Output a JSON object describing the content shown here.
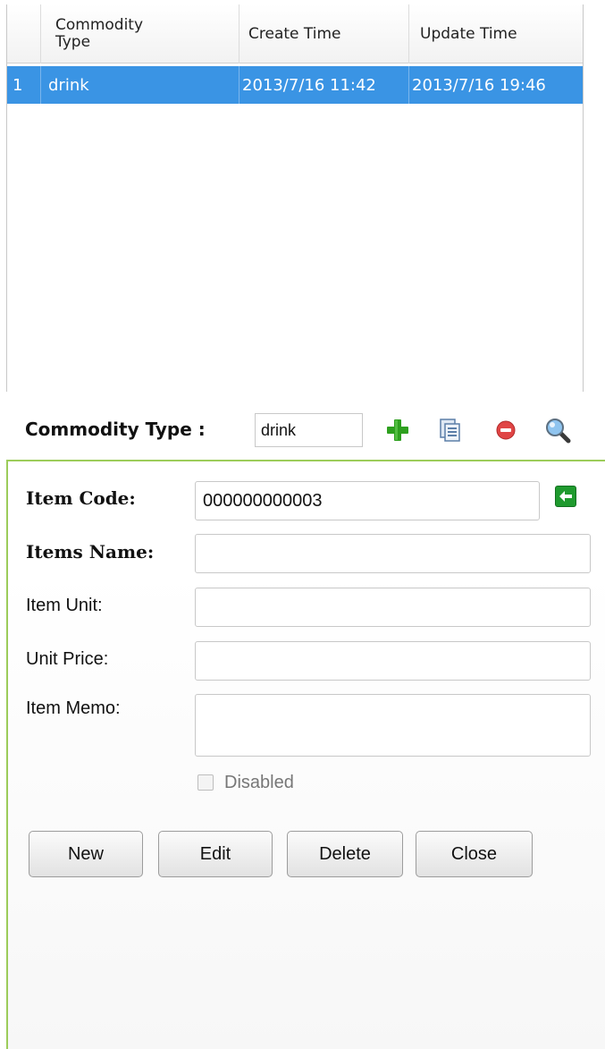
{
  "grid": {
    "columns": [
      "",
      "Commodity Type",
      "Create Time",
      "Update Time"
    ],
    "rows": [
      {
        "index": "1",
        "type": "drink",
        "create_time": "2013/7/16 11:42",
        "update_time": "2013/7/16 19:46",
        "selected": true
      }
    ]
  },
  "toolbar": {
    "label": "Commodity Type :",
    "type_value": "drink",
    "icons": [
      "add-icon",
      "save-icon",
      "remove-icon",
      "search-icon"
    ]
  },
  "form": {
    "item_code": {
      "label": "Item Code:",
      "value": "000000000003"
    },
    "items_name": {
      "label": "Items Name:",
      "value": ""
    },
    "item_unit": {
      "label": "Item Unit:",
      "value": ""
    },
    "unit_price": {
      "label": "Unit Price:",
      "value": ""
    },
    "item_memo": {
      "label": "Item Memo:",
      "value": ""
    },
    "disabled": {
      "label": "Disabled",
      "checked": false
    },
    "buttons": {
      "new": "New",
      "edit": "Edit",
      "delete": "Delete",
      "close": "Close"
    }
  },
  "colors": {
    "selection": "#3a94e4",
    "panel_border": "#9ccc5a",
    "add": "#2ea01f",
    "remove": "#e04545",
    "back": "#1f9a2e"
  }
}
